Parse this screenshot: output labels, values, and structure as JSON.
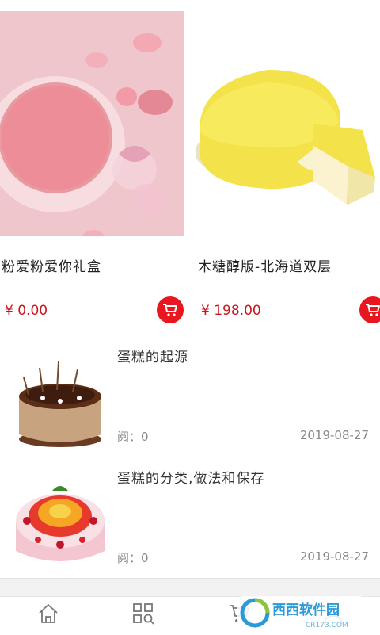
{
  "products": [
    {
      "name": "粉爱粉爱你礼盒",
      "price": "¥ 0.00",
      "image": "pink-cake-photo",
      "cart_icon": "cart-icon"
    },
    {
      "name": "木糖醇版-北海道双层",
      "price": "¥ 198.00",
      "image": "yellow-cheesecake-photo",
      "cart_icon": "cart-icon"
    }
  ],
  "articles": [
    {
      "title": "蛋糕的起源",
      "read": "阅：0",
      "date": "2019-08-27",
      "image": "chocolate-cake-thumbnail"
    },
    {
      "title": "蛋糕的分类,做法和保存",
      "read": "阅：0",
      "date": "2019-08-27",
      "image": "fruit-cake-thumbnail"
    }
  ],
  "tabbar": {
    "icons": [
      "home-icon",
      "category-search-icon",
      "cart-icon",
      "user-icon"
    ]
  },
  "watermark": {
    "text": "西西软件园",
    "sub": "CR173.COM"
  },
  "colors": {
    "accent": "#e8161f",
    "price": "#c8161d",
    "background": "#f2f2f2"
  }
}
